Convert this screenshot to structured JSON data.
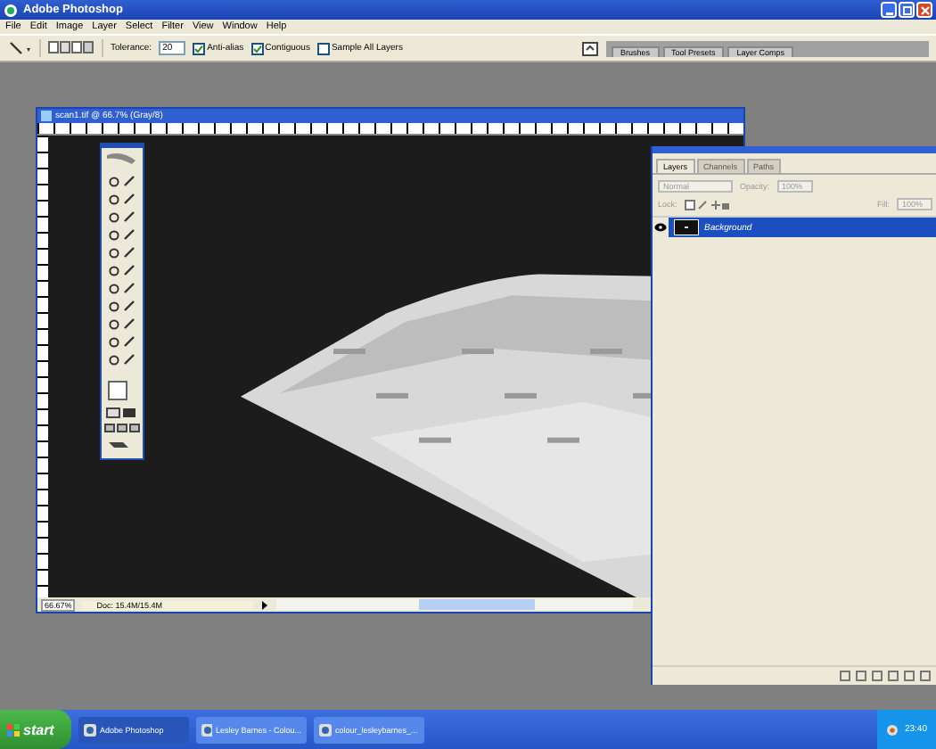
{
  "window": {
    "title": "Adobe Photoshop"
  },
  "menu": [
    "File",
    "Edit",
    "Image",
    "Layer",
    "Select",
    "Filter",
    "View",
    "Window",
    "Help"
  ],
  "options_bar": {
    "tolerance_label": "Tolerance:",
    "tolerance": "20",
    "checkboxes": [
      {
        "label": "Anti-alias",
        "checked": true
      },
      {
        "label": "Contiguous",
        "checked": true
      },
      {
        "label": "Sample All Layers",
        "checked": false
      }
    ],
    "palette_tabs": [
      "Brushes",
      "Tool Presets",
      "Layer Comps"
    ]
  },
  "document": {
    "title": "scan1.tif @ 66.7% (Gray/8)",
    "zoom": "66.67%",
    "doc_size": "Doc: 15.4M/15.4M"
  },
  "layers_panel": {
    "tabs": [
      {
        "label": "Layers",
        "selected": true
      },
      {
        "label": "Channels",
        "selected": false
      },
      {
        "label": "Paths",
        "selected": false
      }
    ],
    "blend_mode": "Normal",
    "opacity_label": "Opacity:",
    "opacity": "100%",
    "lock_label": "Lock:",
    "fill_label": "Fill:",
    "fill": "100%",
    "layers": [
      {
        "name": "Background",
        "selected": true,
        "visible": true
      }
    ]
  },
  "taskbar": {
    "start": "start",
    "items": [
      {
        "label": "Adobe Photoshop",
        "selected": true
      },
      {
        "label": "Lesley Barnes - Colou...",
        "selected": false
      },
      {
        "label": "colour_lesleybarnes_...",
        "selected": false
      }
    ],
    "clock": "23:40"
  }
}
